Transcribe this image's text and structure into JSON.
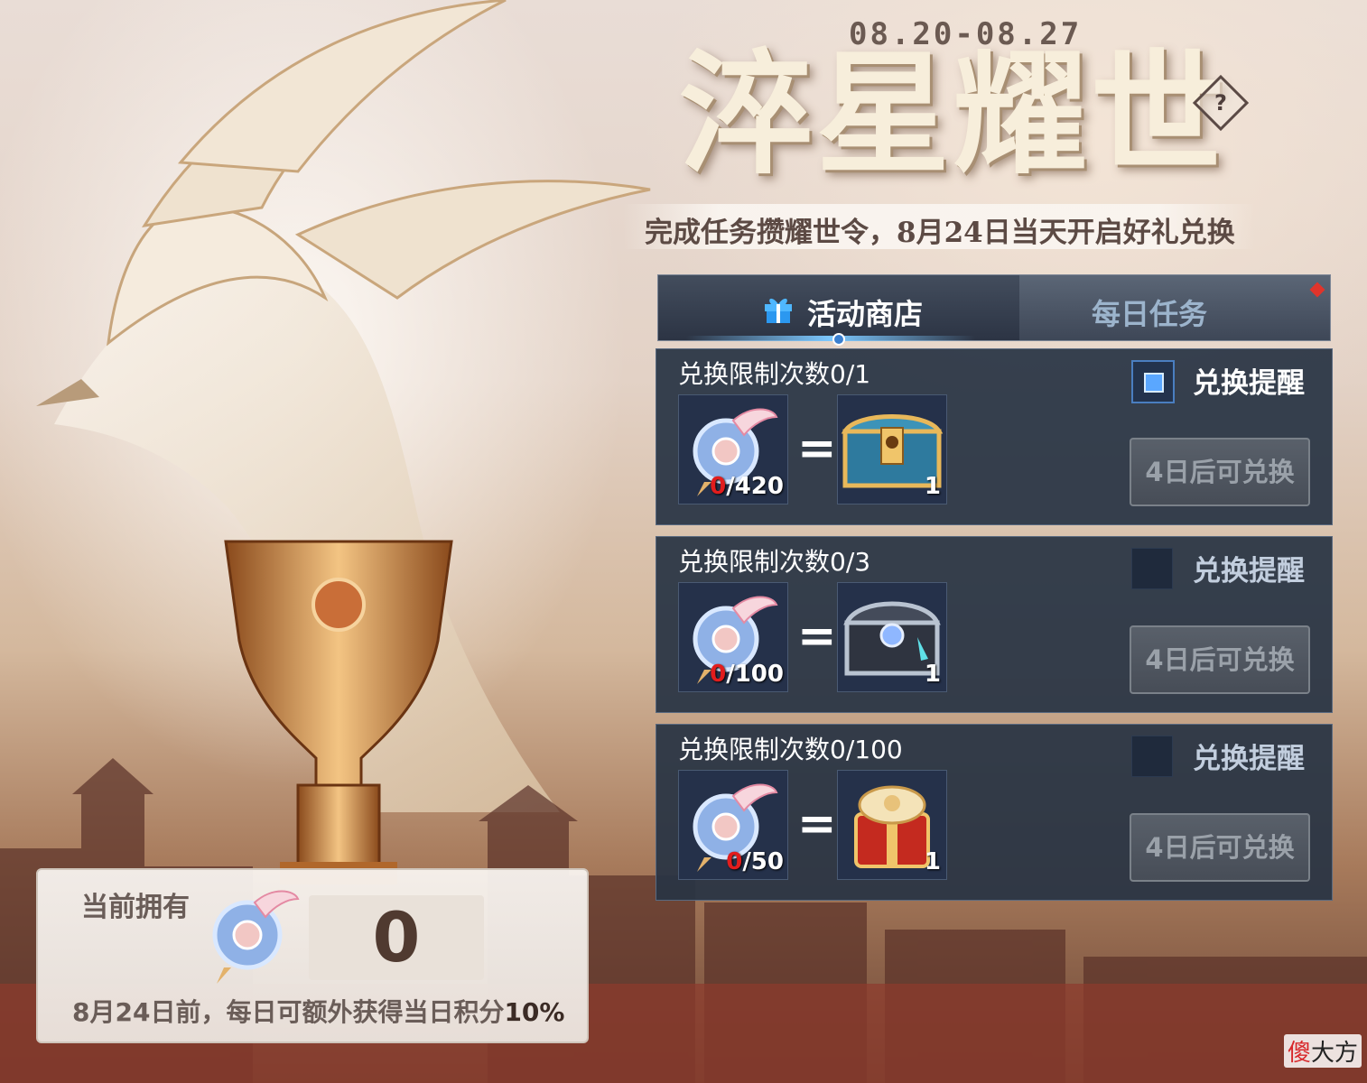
{
  "header": {
    "date_range": "08.20-08.27",
    "title": "淬星耀世",
    "help_symbol": "?",
    "subtitle": "完成任务攒耀世令，8月24日当天开启好礼兑换"
  },
  "tabs": [
    {
      "label": "活动商店",
      "active": true
    },
    {
      "label": "每日任务",
      "active": false,
      "has_red_dot": true
    }
  ],
  "exchanges": [
    {
      "limit": "兑换限制次数0/1",
      "cost_current": "0",
      "cost_required": "/420",
      "equals": "=",
      "reward_count": "1",
      "reward_icon": "gold-blue-chest-icon",
      "remind_label": "兑换提醒",
      "remind_checked": true,
      "button_label": "4日后可兑换"
    },
    {
      "limit": "兑换限制次数0/3",
      "cost_current": "0",
      "cost_required": "/100",
      "equals": "=",
      "reward_count": "1",
      "reward_icon": "silver-dark-chest-icon",
      "remind_label": "兑换提醒",
      "remind_checked": false,
      "button_label": "4日后可兑换"
    },
    {
      "limit": "兑换限制次数0/100",
      "cost_current": "0",
      "cost_required": "/50",
      "equals": "=",
      "reward_count": "1",
      "reward_icon": "red-gift-box-icon",
      "remind_label": "兑换提醒",
      "remind_checked": false,
      "button_label": "4日后可兑换"
    }
  ],
  "owned": {
    "label": "当前拥有",
    "value": "0",
    "note_prefix": "8月24日前，每日可额外获得当日积分",
    "note_percent": "10%"
  },
  "watermark": {
    "red": "傻",
    "rest": "大方"
  },
  "colors": {
    "panel_bg": "#283444",
    "accent_blue": "#5aa7ff",
    "red_count": "#e21d1d",
    "title_cream": "#f7eedb"
  }
}
